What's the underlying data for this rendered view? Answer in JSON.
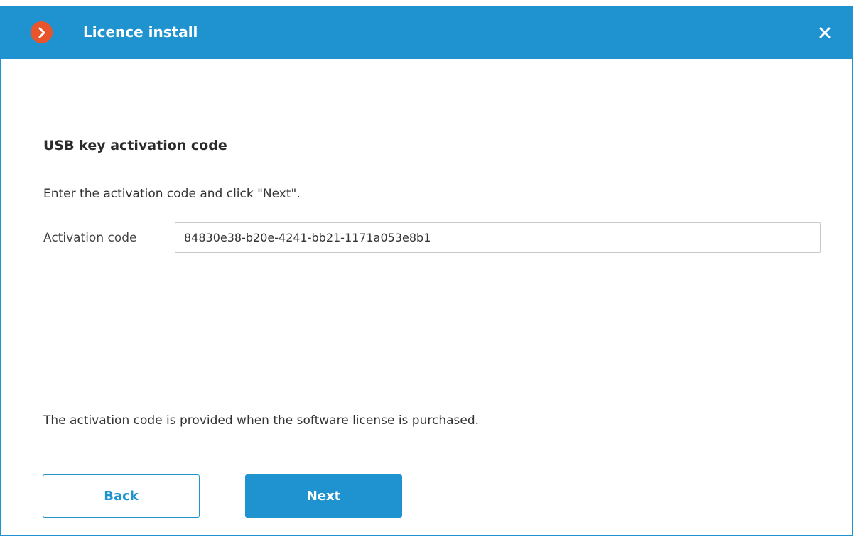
{
  "window": {
    "title": "Licence install",
    "accent_color": "#1e93cf",
    "logo_color": "#e8542c",
    "logo_icon": "chevron-right-icon",
    "close_icon": "close-icon"
  },
  "content": {
    "heading": "USB key activation code",
    "instruction": "Enter the activation code and click \"Next\".",
    "activation_field": {
      "label": "Activation code",
      "value": "84830e38-b20e-4241-bb21-1171a053e8b1"
    },
    "note": "The activation code is provided when the software license is purchased."
  },
  "buttons": {
    "back_label": "Back",
    "next_label": "Next"
  }
}
